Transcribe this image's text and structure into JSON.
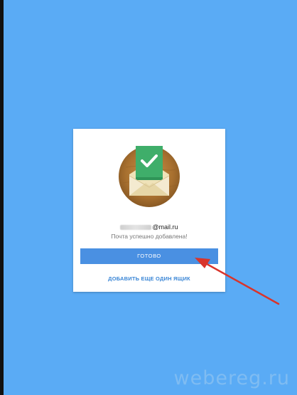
{
  "colors": {
    "background": "#5aabf5",
    "dialog": "#ffffff",
    "primary_button": "#4a90e2",
    "link": "#3a86d6",
    "annotation_arrow": "#d9342b"
  },
  "dialog": {
    "icon": "mail-envelope-check-icon",
    "email_domain": "@mail.ru",
    "status_text": "Почта успешно добавлена!",
    "done_label": "ГОТОВО",
    "add_another_label": "ДОБАВИТЬ ЕЩЕ ОДИН ЯЩИК"
  },
  "watermark": "webereg.ru"
}
